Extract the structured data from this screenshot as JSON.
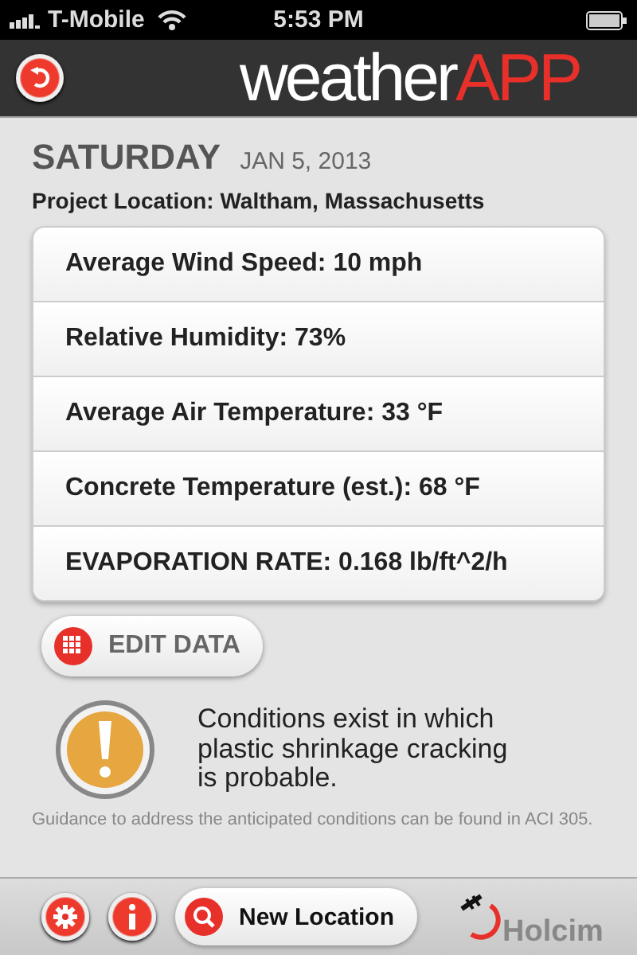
{
  "status_bar": {
    "carrier": "T-Mobile",
    "time": "5:53 PM"
  },
  "header": {
    "logo_main": "weather",
    "logo_accent": "APP"
  },
  "day": "SATURDAY",
  "date": "JAN 5, 2013",
  "location": "Project Location: Waltham, Massachusetts",
  "readings": [
    {
      "label": "Average Wind Speed: 10 mph"
    },
    {
      "label": "Relative Humidity: 73%"
    },
    {
      "label": "Average Air Temperature: 33 °F"
    },
    {
      "label": "Concrete Temperature (est.): 68 °F"
    },
    {
      "label": "EVAPORATION RATE: 0.168 lb/ft^2/h"
    }
  ],
  "edit_button": "EDIT DATA",
  "warning": {
    "message": "Conditions exist in which plastic shrinkage cracking is probable.",
    "guidance": "Guidance to address the anticipated conditions can be found in ACI 305."
  },
  "toolbar": {
    "new_location": "New Location",
    "brand": "Holcim"
  }
}
